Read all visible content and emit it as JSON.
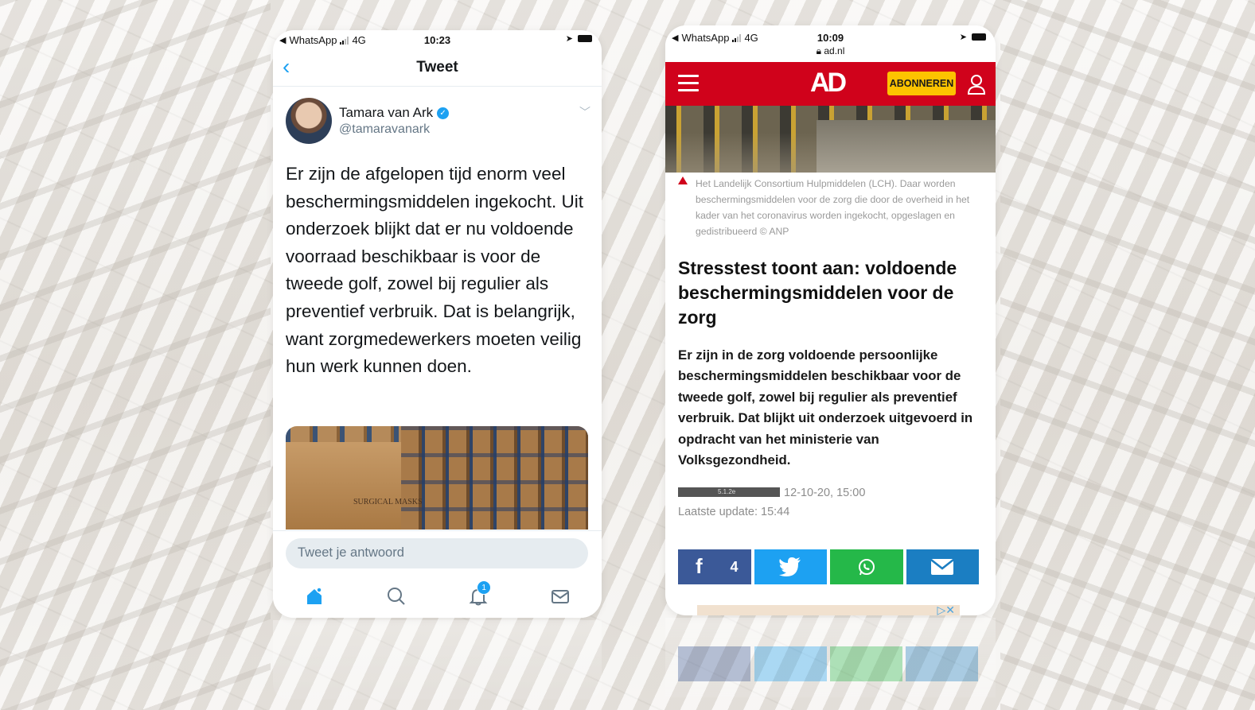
{
  "twitter": {
    "status": {
      "carrier": "WhatsApp",
      "network": "4G",
      "time": "10:23"
    },
    "header_title": "Tweet",
    "author": {
      "name": "Tamara van Ark",
      "handle": "@tamaravanark"
    },
    "tweet_text": "Er zijn de afgelopen tijd enorm veel beschermingsmiddelen ingekocht. Uit onderzoek blijkt dat er nu voldoende voorraad beschikbaar is voor de tweede golf, zowel bij regulier als preventief verbruik. Dat is belangrijk, want zorgmedewerkers moeten veilig hun werk kunnen doen.",
    "media_label": "SURGICAL MASKS",
    "reply_placeholder": "Tweet je antwoord",
    "notification_count": "1",
    "colors": {
      "accent": "#1da1f2"
    },
    "icons": [
      "back-chevron-icon",
      "verified-icon",
      "chevron-down-icon",
      "home-icon",
      "search-icon",
      "bell-icon",
      "mail-icon"
    ]
  },
  "ad": {
    "status": {
      "carrier": "WhatsApp",
      "network": "4G",
      "time": "10:09",
      "url": "ad.nl"
    },
    "logo": "AD",
    "subscribe_label": "ABONNEREN",
    "caption": "Het Landelijk Consortium Hulpmiddelen (LCH). Daar worden beschermingsmiddelen voor de zorg die door de overheid in het kader van het coronavirus worden ingekocht, opgeslagen en gedistribueerd © ANP",
    "headline": "Stresstest toont aan: voldoende beschermingsmiddelen voor de zorg",
    "lead": "Er zijn in de zorg voldoende persoonlijke beschermingsmiddelen beschikbaar voor de tweede golf, zowel bij regulier als preventief verbruik. Dat blijkt uit onderzoek uitgevoerd in opdracht van het ministerie van Volksgezondheid.",
    "audio_bar_label": "5.1.2e",
    "date": "12-10-20, 15:00",
    "last_update": "Laatste update: 15:44",
    "facebook_count": "4",
    "colors": {
      "brand": "#d0021b",
      "subscribe": "#fdc300",
      "facebook": "#3b5998",
      "twitter": "#1da1f2",
      "whatsapp": "#25b849",
      "mail": "#1b7ec2"
    }
  }
}
